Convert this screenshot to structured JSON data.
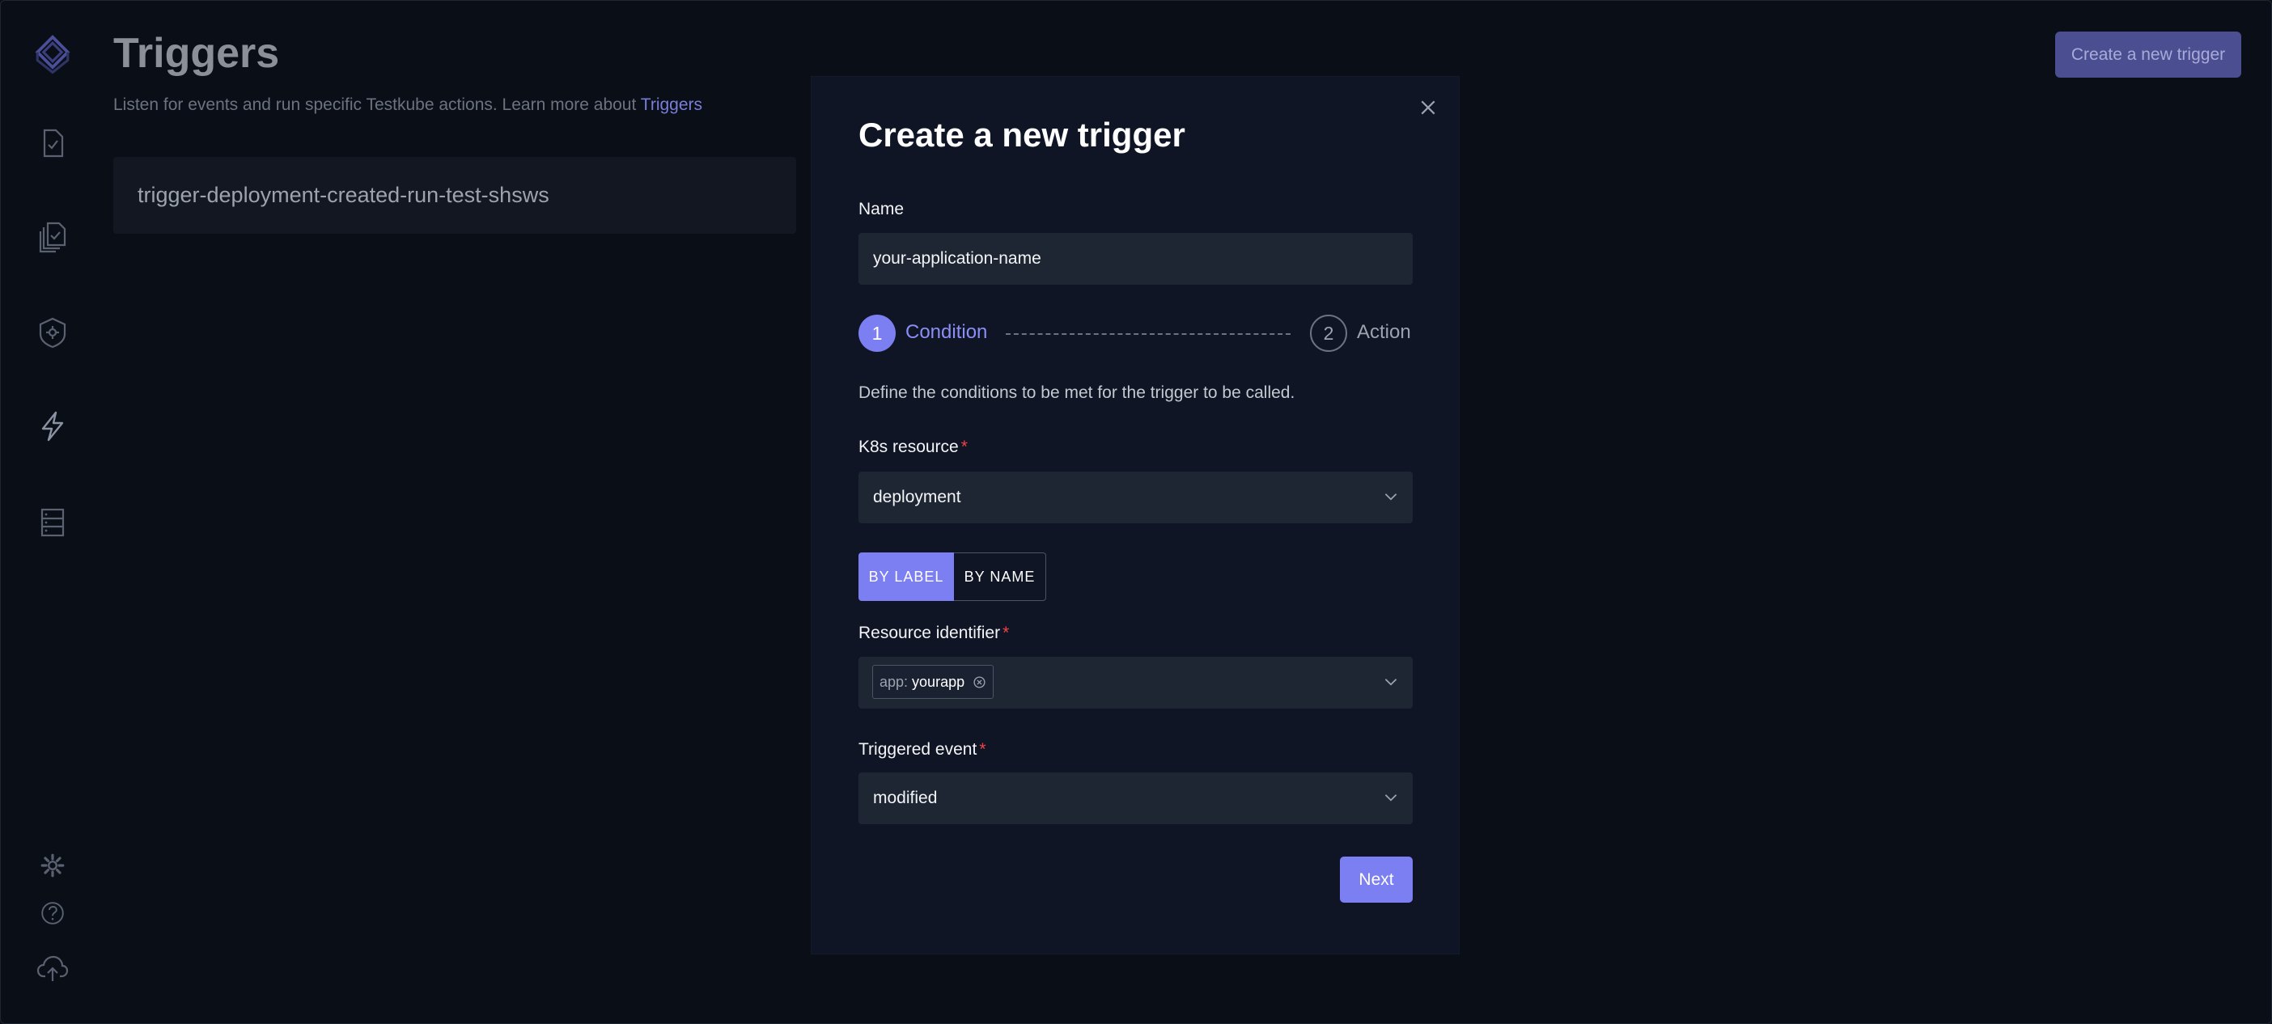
{
  "page": {
    "title": "Triggers",
    "subtitle_text": "Listen for events and run specific Testkube actions. Learn more about",
    "subtitle_link": "Triggers",
    "create_button": "Create a new trigger",
    "triggers": [
      "trigger-deployment-created-run-test-shsws"
    ]
  },
  "sidebar": {
    "icons": [
      "logo-icon",
      "test-icon",
      "test-suites-icon",
      "executors-icon",
      "triggers-icon",
      "sources-icon",
      "settings-icon",
      "help-icon",
      "upload-icon"
    ]
  },
  "modal": {
    "title": "Create a new trigger",
    "name_label": "Name",
    "name_value": "your-application-name",
    "step1_number": "1",
    "step1_label": "Condition",
    "step2_number": "2",
    "step2_label": "Action",
    "description": "Define the conditions to be met for the trigger to be called.",
    "k8s_label": "K8s resource",
    "k8s_value": "deployment",
    "toggle_by_label": "BY LABEL",
    "toggle_by_name": "BY NAME",
    "resource_id_label": "Resource identifier",
    "resource_tag_key": "app:",
    "resource_tag_value": "yourapp",
    "event_label": "Triggered event",
    "event_value": "modified",
    "next_button": "Next",
    "required_mark": "*"
  },
  "colors": {
    "accent": "#7c7ff2",
    "background": "#0a0e16",
    "modal": "#0f1525",
    "input": "#1e2533",
    "required": "#ef4444"
  }
}
